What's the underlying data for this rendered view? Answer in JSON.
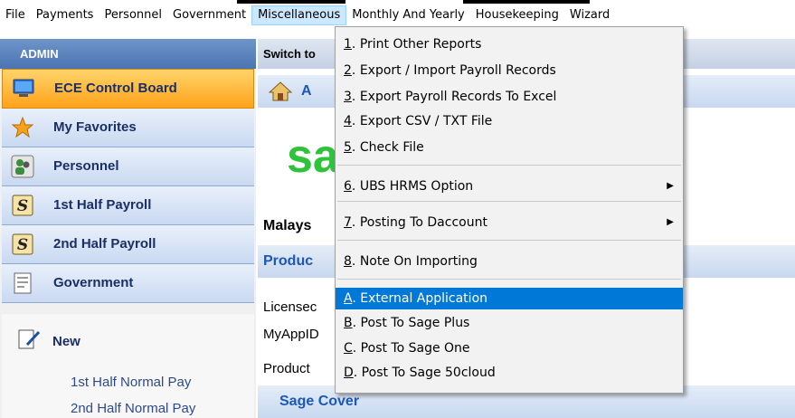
{
  "menubar": {
    "items": [
      "File",
      "Payments",
      "Personnel",
      "Government",
      "Miscellaneous",
      "Monthly And Yearly",
      "Housekeeping",
      "Wizard"
    ]
  },
  "sidebar": {
    "header": "ADMIN",
    "items": [
      {
        "label": "ECE Control Board",
        "icon": "monitor-icon"
      },
      {
        "label": "My Favorites",
        "icon": "star-icon"
      },
      {
        "label": "Personnel",
        "icon": "people-icon"
      },
      {
        "label": "1st Half Payroll",
        "icon": "dollar-icon"
      },
      {
        "label": "2nd Half Payroll",
        "icon": "dollar-icon"
      },
      {
        "label": "Government",
        "icon": "document-icon"
      }
    ],
    "sub": {
      "new_label": "New",
      "links": [
        "1st Half Normal Pay",
        "2nd Half Normal Pay"
      ]
    }
  },
  "main": {
    "switch_label": "Switch to",
    "home_label": "A",
    "logo": "sa",
    "malaysia": "Malays",
    "product_band": "Produc",
    "licensed": "Licensec",
    "myappid": "MyAppID",
    "product": "Product",
    "cover_band": "Sage Cover"
  },
  "dropdown": {
    "items": [
      {
        "key": "1",
        "rest": ". Print Other Reports"
      },
      {
        "key": "2",
        "rest": ". Export / Import Payroll Records"
      },
      {
        "key": "3",
        "rest": ". Export Payroll Records To Excel"
      },
      {
        "key": "4",
        "rest": ". Export CSV / TXT File"
      },
      {
        "key": "5",
        "rest": ". Check File"
      },
      {
        "key": "6",
        "rest": ". UBS HRMS Option"
      },
      {
        "key": "7",
        "rest": ". Posting To Daccount"
      },
      {
        "key": "8",
        "rest": ". Note On Importing"
      },
      {
        "key": "A",
        "rest": ". External Application"
      },
      {
        "key": "B",
        "rest": ". Post To Sage Plus"
      },
      {
        "key": "C",
        "rest": ". Post To Sage One"
      },
      {
        "key": "D",
        "rest": ". Post To Sage 50cloud"
      }
    ]
  },
  "colors": {
    "highlight": "#0078d7",
    "sage_green": "#2ec33a",
    "active_item": "#ffa21a"
  }
}
